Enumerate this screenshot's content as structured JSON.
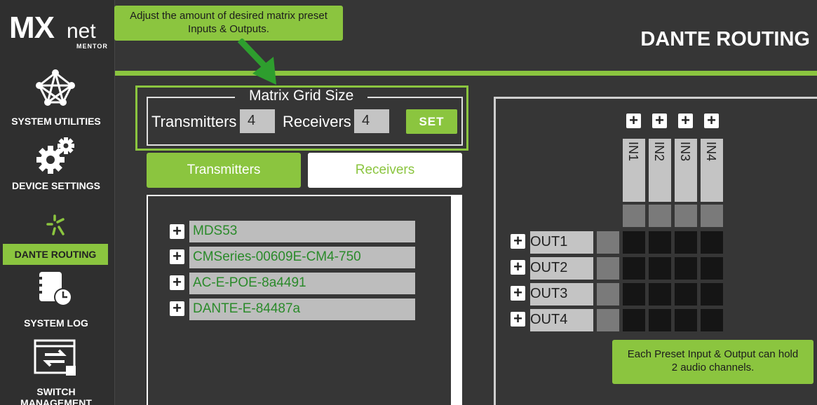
{
  "sidebar": {
    "logo_main": "MX",
    "logo_net": "net",
    "logo_sub": "MENTOR",
    "items": [
      {
        "label": "SYSTEM UTILITIES",
        "icon": "network-globe-icon"
      },
      {
        "label": "DEVICE SETTINGS",
        "icon": "gears-icon"
      },
      {
        "label": "DANTE ROUTING",
        "icon": "dante-logo-icon",
        "active": true
      },
      {
        "label": "SYSTEM LOG",
        "icon": "log-clock-icon"
      },
      {
        "label": "SWITCH MANAGEMENT",
        "icon": "switch-icon"
      }
    ]
  },
  "header": {
    "title": "DANTE ROUTING"
  },
  "tooltips": {
    "top_line1": "Adjust the amount of desired matrix preset",
    "top_line2": "Inputs & Outputs.",
    "bottom_line1": "Each Preset Input & Output can hold",
    "bottom_line2": "2 audio channels."
  },
  "grid_size": {
    "title": "Matrix Grid Size",
    "transmitters_label": "Transmitters",
    "transmitters_value": "4",
    "receivers_label": "Receivers",
    "receivers_value": "4",
    "set_label": "SET"
  },
  "tabs": {
    "transmitters": "Transmitters",
    "receivers": "Receivers"
  },
  "devices": [
    "MDS53",
    "CMSeries-00609E-CM4-750",
    "AC-E-POE-8a4491",
    "DANTE-E-84487a"
  ],
  "matrix": {
    "inputs": [
      "IN1",
      "IN2",
      "IN3",
      "IN4"
    ],
    "outputs": [
      "OUT1",
      "OUT2",
      "OUT3",
      "OUT4"
    ]
  },
  "colors": {
    "accent": "#8bc53f",
    "background": "#363636",
    "device_text": "#2a8a2a"
  }
}
